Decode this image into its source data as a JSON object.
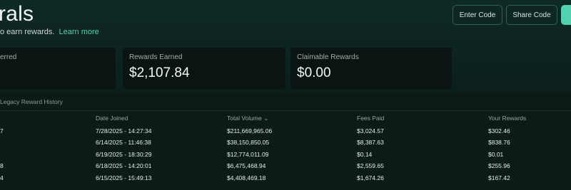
{
  "header": {
    "title": "rals",
    "subtitle": "o earn rewards.",
    "learn_more": "Learn more",
    "buttons": {
      "enter_code": "Enter Code",
      "share_code": "Share Code",
      "third": ""
    }
  },
  "stats": [
    {
      "label": "erred",
      "value": ""
    },
    {
      "label": "Rewards Earned",
      "value": "$2,107.84"
    },
    {
      "label": "Claimable Rewards",
      "value": "$0.00"
    }
  ],
  "section_title": "Legacy Reward History",
  "table": {
    "columns": [
      "",
      "Date Joined",
      "Total Volume",
      "Fees Paid",
      "Your Rewards"
    ],
    "sort_icon": "chevron-down",
    "rows": [
      [
        "7",
        "7/28/2025 - 14:27:34",
        "$211,669,965.06",
        "$3,024.57",
        "$302.46"
      ],
      [
        "",
        "6/14/2025 - 11:46:38",
        "$38,150,850.05",
        "$8,387.63",
        "$838.76"
      ],
      [
        "",
        "6/19/2025 - 18:30:29",
        "$12,774,011.09",
        "$0.14",
        "$0.01"
      ],
      [
        "8",
        "6/18/2025 - 14:20:01",
        "$6,475,468.94",
        "$2,559.65",
        "$255.96"
      ],
      [
        "4",
        "6/15/2025 - 15:49:13",
        "$4,408,469.18",
        "$1,674.26",
        "$167.42"
      ]
    ]
  },
  "colors": {
    "accent": "#4fd1b1",
    "background": "#0c1a18"
  }
}
